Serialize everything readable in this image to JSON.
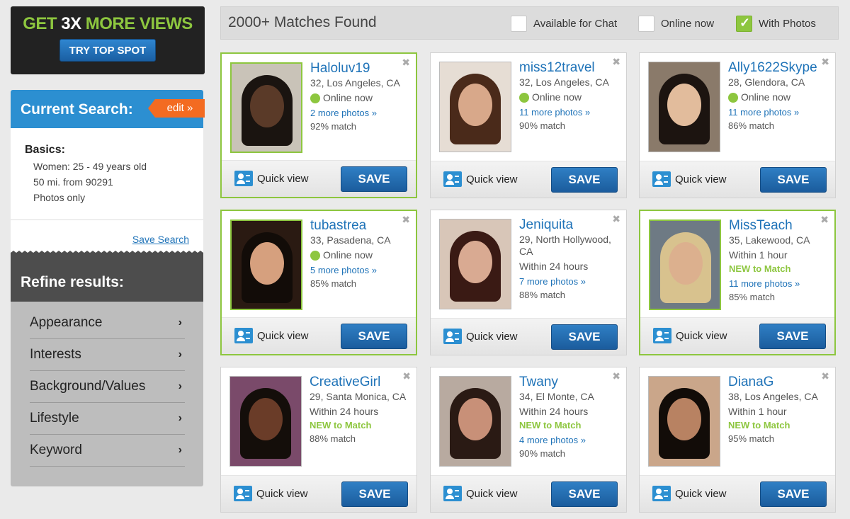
{
  "promo": {
    "headline_green1": "GET ",
    "headline_white": "3X",
    "headline_green2": " MORE VIEWS",
    "button": "TRY TOP SPOT"
  },
  "search": {
    "title": "Current Search:",
    "edit": "edit »",
    "basics_title": "Basics:",
    "lines": [
      "Women: 25 - 49 years old",
      "50 mi. from 90291",
      "Photos only"
    ],
    "save_search": "Save Search"
  },
  "refine": {
    "title": "Refine results:",
    "items": [
      "Appearance",
      "Interests",
      "Background/Values",
      "Lifestyle",
      "Keyword"
    ]
  },
  "results": {
    "title": "2000+ Matches Found",
    "filters": [
      {
        "label": "Available for Chat",
        "checked": false
      },
      {
        "label": "Online now",
        "checked": false
      },
      {
        "label": "With Photos",
        "checked": true
      }
    ]
  },
  "card_labels": {
    "quick_view": "Quick view",
    "save": "SAVE",
    "close": "✖"
  },
  "profiles": [
    {
      "name": "Haloluv19",
      "location": "32, Los Angeles, CA",
      "status": "Online now",
      "online": true,
      "new": "",
      "more": "2 more photos »",
      "match": "92% match",
      "featured": true,
      "skin": "#5a3a28",
      "hair": "#1a1410",
      "bg": "#c9c3b8"
    },
    {
      "name": "miss12travel",
      "location": "32, Los Angeles, CA",
      "status": "Online now",
      "online": true,
      "new": "",
      "more": "11 more photos »",
      "match": "90% match",
      "featured": false,
      "skin": "#d8a88a",
      "hair": "#4a2a1a",
      "bg": "#e6ddd4"
    },
    {
      "name": "Ally1622Skype",
      "location": "28, Glendora, CA",
      "status": "Online now",
      "online": true,
      "new": "",
      "more": "11 more photos »",
      "match": "86% match",
      "featured": false,
      "skin": "#e2bc9c",
      "hair": "#1c1410",
      "bg": "#8a7a6a"
    },
    {
      "name": "tubastrea",
      "location": "33, Pasadena, CA",
      "status": "Online now",
      "online": true,
      "new": "",
      "more": "5 more photos »",
      "match": "85% match",
      "featured": true,
      "skin": "#d6a07e",
      "hair": "#120c08",
      "bg": "#2a1a12"
    },
    {
      "name": "Jeniquita",
      "location": "29, North Hollywood, CA",
      "status": "Within 24 hours",
      "online": false,
      "new": "",
      "more": "7 more photos »",
      "match": "88% match",
      "featured": false,
      "skin": "#d9aa92",
      "hair": "#3a1a14",
      "bg": "#d8c6b8"
    },
    {
      "name": "MissTeach",
      "location": "35, Lakewood, CA",
      "status": "Within 1 hour",
      "online": false,
      "new": "NEW to Match",
      "more": "11 more photos »",
      "match": "85% match",
      "featured": true,
      "skin": "#dcb08e",
      "hair": "#d8c28e",
      "bg": "#6e7a84"
    },
    {
      "name": "CreativeGirl",
      "location": "29, Santa Monica, CA",
      "status": "Within 24 hours",
      "online": false,
      "new": "NEW to Match",
      "more": "",
      "match": "88% match",
      "featured": false,
      "skin": "#6a3c28",
      "hair": "#140e0a",
      "bg": "#7a4a6a"
    },
    {
      "name": "Twany",
      "location": "34, El Monte, CA",
      "status": "Within 24 hours",
      "online": false,
      "new": "NEW to Match",
      "more": "4 more photos »",
      "match": "90% match",
      "featured": false,
      "skin": "#c89078",
      "hair": "#2a1a14",
      "bg": "#b8aaa0"
    },
    {
      "name": "DianaG",
      "location": "38, Los Angeles, CA",
      "status": "Within 1 hour",
      "online": false,
      "new": "NEW to Match",
      "more": "",
      "match": "95% match",
      "featured": false,
      "skin": "#b88262",
      "hair": "#120c08",
      "bg": "#caa68a"
    }
  ]
}
